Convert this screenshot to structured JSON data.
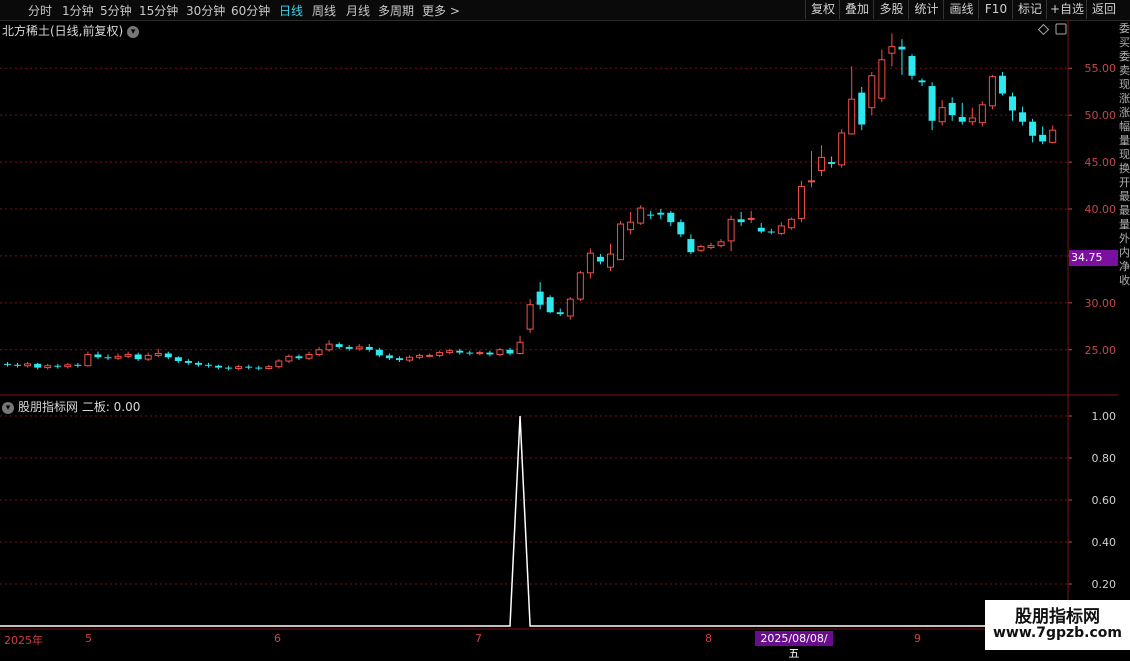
{
  "toolbar": {
    "periods": [
      "分时",
      "1分钟",
      "5分钟",
      "15分钟",
      "30分钟",
      "60分钟",
      "日线",
      "周线",
      "月线",
      "多周期",
      "更多 >"
    ],
    "active_period": "日线",
    "right_buttons": [
      "复权",
      "叠加",
      "多股",
      "统计",
      "画线",
      "F10",
      "标记",
      "+自选",
      "返回"
    ]
  },
  "chart_title": "北方稀土(日线,前复权)",
  "indicator_title": "股朋指标网 二板: 0.00",
  "current_price_label": "34.75",
  "time_axis": {
    "year_label": "2025年",
    "month_labels": [
      "5",
      "6",
      "7",
      "8",
      "9"
    ],
    "cursor_date": "2025/08/08/五"
  },
  "side_text": "委买委卖现涨涨幅量现换开最最量外内净收",
  "watermark": {
    "line1": "股朋指标网",
    "line2": "www.7gpzb.com"
  },
  "colors": {
    "up": "#f0504a",
    "down": "#2ee8f0",
    "grid": "#7a1414",
    "axis_text": "#c04848",
    "signal": "#ffffff"
  },
  "chart_data": [
    {
      "type": "candlestick",
      "title": "北方稀土(日线,前复权)",
      "ylim": [
        20.5,
        59.5
      ],
      "yticks": [
        25.0,
        30.0,
        35.0,
        40.0,
        45.0,
        50.0,
        55.0
      ],
      "candles": [
        [
          23.5,
          23.4,
          23.7,
          23.2
        ],
        [
          23.4,
          23.3,
          23.6,
          23.1
        ],
        [
          23.3,
          23.5,
          23.7,
          23.1
        ],
        [
          23.5,
          23.1,
          23.6,
          22.9
        ],
        [
          23.1,
          23.3,
          23.5,
          22.9
        ],
        [
          23.3,
          23.2,
          23.5,
          23.0
        ],
        [
          23.2,
          23.4,
          23.6,
          23.0
        ],
        [
          23.4,
          23.3,
          23.6,
          23.1
        ],
        [
          23.3,
          24.5,
          24.8,
          23.2
        ],
        [
          24.5,
          24.2,
          24.8,
          24.0
        ],
        [
          24.2,
          24.1,
          24.5,
          23.9
        ],
        [
          24.1,
          24.3,
          24.6,
          23.9
        ],
        [
          24.3,
          24.5,
          24.8,
          24.1
        ],
        [
          24.5,
          24.0,
          24.7,
          23.8
        ],
        [
          24.0,
          24.4,
          24.7,
          23.8
        ],
        [
          24.4,
          24.6,
          25.1,
          24.2
        ],
        [
          24.6,
          24.2,
          24.8,
          24.0
        ],
        [
          24.2,
          23.8,
          24.3,
          23.6
        ],
        [
          23.8,
          23.6,
          24.0,
          23.4
        ],
        [
          23.6,
          23.4,
          23.8,
          23.2
        ],
        [
          23.4,
          23.3,
          23.6,
          23.1
        ],
        [
          23.3,
          23.1,
          23.4,
          22.9
        ],
        [
          23.1,
          23.0,
          23.3,
          22.8
        ],
        [
          23.0,
          23.2,
          23.4,
          22.8
        ],
        [
          23.2,
          23.1,
          23.4,
          22.9
        ],
        [
          23.1,
          23.0,
          23.3,
          22.8
        ],
        [
          23.0,
          23.2,
          23.4,
          22.9
        ],
        [
          23.2,
          23.8,
          24.0,
          23.0
        ],
        [
          23.8,
          24.3,
          24.5,
          23.6
        ],
        [
          24.3,
          24.1,
          24.5,
          23.9
        ],
        [
          24.1,
          24.5,
          24.8,
          23.9
        ],
        [
          24.5,
          25.0,
          25.3,
          24.3
        ],
        [
          25.0,
          25.6,
          26.0,
          24.8
        ],
        [
          25.6,
          25.3,
          25.8,
          25.1
        ],
        [
          25.3,
          25.1,
          25.5,
          24.9
        ],
        [
          25.1,
          25.3,
          25.6,
          24.9
        ],
        [
          25.3,
          25.0,
          25.6,
          24.8
        ],
        [
          25.0,
          24.4,
          25.2,
          24.2
        ],
        [
          24.4,
          24.1,
          24.6,
          23.9
        ],
        [
          24.1,
          23.9,
          24.3,
          23.7
        ],
        [
          23.9,
          24.2,
          24.4,
          23.7
        ],
        [
          24.2,
          24.4,
          24.6,
          24.0
        ],
        [
          24.4,
          24.4,
          24.6,
          24.2
        ],
        [
          24.4,
          24.7,
          24.9,
          24.2
        ],
        [
          24.7,
          24.9,
          25.1,
          24.5
        ],
        [
          24.9,
          24.7,
          25.1,
          24.5
        ],
        [
          24.7,
          24.6,
          24.9,
          24.4
        ],
        [
          24.6,
          24.7,
          24.9,
          24.4
        ],
        [
          24.7,
          24.5,
          24.9,
          24.3
        ],
        [
          24.5,
          25.0,
          25.2,
          24.3
        ],
        [
          25.0,
          24.6,
          25.2,
          24.4
        ],
        [
          24.6,
          25.8,
          26.5,
          24.5
        ],
        [
          27.2,
          29.8,
          30.4,
          26.8
        ],
        [
          31.2,
          29.8,
          32.2,
          29.3
        ],
        [
          30.6,
          29.0,
          30.8,
          28.9
        ],
        [
          29.0,
          28.8,
          29.4,
          28.6
        ],
        [
          28.6,
          30.4,
          30.6,
          28.2
        ],
        [
          30.4,
          33.2,
          33.4,
          30.2
        ],
        [
          33.2,
          35.3,
          35.8,
          32.6
        ],
        [
          34.9,
          34.4,
          35.2,
          34.1
        ],
        [
          33.8,
          35.2,
          36.3,
          33.4
        ],
        [
          34.6,
          38.4,
          38.7,
          34.6
        ],
        [
          37.8,
          38.6,
          39.7,
          37.3
        ],
        [
          38.5,
          40.1,
          40.4,
          38.3
        ],
        [
          39.4,
          39.3,
          39.8,
          38.9
        ],
        [
          39.6,
          39.4,
          40.0,
          38.9
        ],
        [
          39.6,
          38.6,
          39.8,
          38.2
        ],
        [
          38.6,
          37.3,
          38.9,
          37.0
        ],
        [
          36.8,
          35.4,
          37.3,
          35.2
        ],
        [
          35.6,
          36.0,
          36.2,
          35.4
        ],
        [
          35.9,
          36.1,
          36.4,
          35.7
        ],
        [
          36.1,
          36.5,
          36.8,
          35.9
        ],
        [
          36.6,
          38.9,
          39.3,
          35.5
        ],
        [
          38.9,
          38.6,
          39.7,
          38.2
        ],
        [
          38.9,
          39.0,
          39.8,
          38.5
        ],
        [
          38.0,
          37.6,
          38.5,
          37.4
        ],
        [
          37.6,
          37.5,
          37.9,
          37.3
        ],
        [
          37.4,
          38.2,
          38.6,
          37.2
        ],
        [
          38.0,
          38.9,
          39.1,
          37.8
        ],
        [
          39.0,
          42.4,
          43.0,
          38.6
        ],
        [
          43.0,
          43.0,
          46.2,
          42.3
        ],
        [
          44.1,
          45.5,
          46.8,
          43.5
        ],
        [
          45.0,
          44.8,
          45.6,
          44.4
        ],
        [
          44.7,
          48.1,
          48.5,
          44.4
        ],
        [
          48.0,
          51.7,
          55.2,
          47.9
        ],
        [
          52.4,
          49.0,
          53.0,
          48.4
        ],
        [
          50.8,
          54.2,
          54.6,
          50.0
        ],
        [
          51.8,
          55.9,
          57.0,
          51.4
        ],
        [
          56.6,
          57.3,
          58.7,
          55.2
        ],
        [
          57.3,
          57.0,
          58.1,
          54.3
        ],
        [
          56.3,
          54.2,
          56.5,
          53.8
        ],
        [
          53.7,
          53.5,
          53.9,
          53.1
        ],
        [
          53.1,
          49.4,
          53.5,
          48.4
        ],
        [
          49.3,
          50.8,
          51.6,
          48.9
        ],
        [
          51.3,
          50.0,
          51.9,
          49.4
        ],
        [
          49.8,
          49.3,
          51.3,
          49.0
        ],
        [
          49.3,
          49.7,
          50.8,
          48.9
        ],
        [
          49.2,
          51.1,
          51.5,
          48.8
        ],
        [
          51.0,
          54.1,
          54.3,
          50.6
        ],
        [
          54.2,
          52.3,
          54.6,
          52.1
        ],
        [
          52.0,
          50.5,
          52.4,
          49.4
        ],
        [
          50.3,
          49.3,
          50.9,
          48.9
        ],
        [
          49.3,
          47.8,
          49.6,
          47.1
        ],
        [
          47.9,
          47.2,
          48.8,
          46.9
        ],
        [
          47.1,
          48.4,
          48.9,
          47.0
        ]
      ]
    },
    {
      "type": "line",
      "title": "股朋指标网 二板",
      "ylim": [
        0,
        1.0
      ],
      "yticks": [
        0.2,
        0.4,
        0.6,
        0.8,
        1.0
      ],
      "series": [
        {
          "name": "二板",
          "peak_index": 51,
          "peak_value": 1.0,
          "base_value": 0.0
        }
      ]
    }
  ]
}
